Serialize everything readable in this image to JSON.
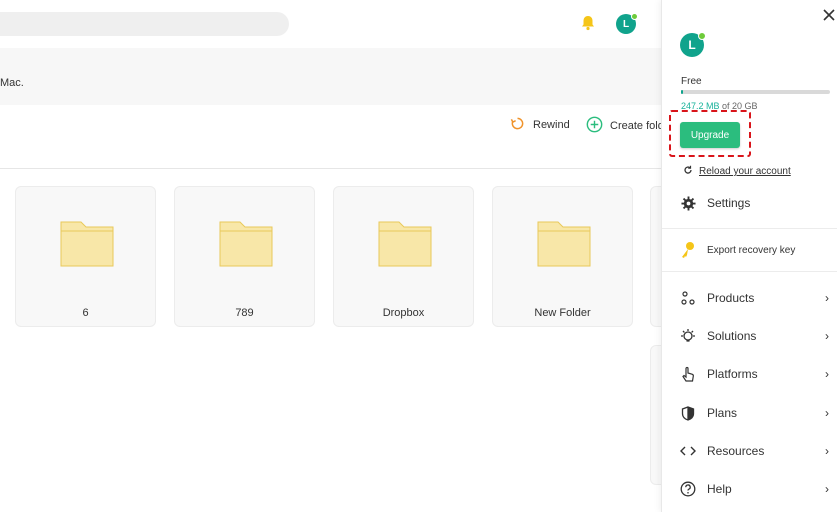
{
  "header": {
    "banner_text": "Mac."
  },
  "toolbar": {
    "rewind_label": "Rewind",
    "create_label": "Create folder"
  },
  "folders": [
    {
      "name": "6"
    },
    {
      "name": "789"
    },
    {
      "name": "Dropbox"
    },
    {
      "name": "New Folder"
    }
  ],
  "user": {
    "initial": "L"
  },
  "account": {
    "plan": "Free",
    "storage_used": "247.2 MB",
    "storage_of": " of 20 GB",
    "storage_fraction": 0.012,
    "upgrade_label": "Upgrade",
    "reload_label": "Reload your account"
  },
  "menu": {
    "settings": "Settings",
    "export": "Export recovery key",
    "products": "Products",
    "solutions": "Solutions",
    "platforms": "Platforms",
    "plans": "Plans",
    "resources": "Resources",
    "help": "Help"
  },
  "colors": {
    "accent": "#10a38c",
    "upgrade": "#2bbd7e",
    "highlight": "#d9141a",
    "folder": "#f8e7a8"
  }
}
